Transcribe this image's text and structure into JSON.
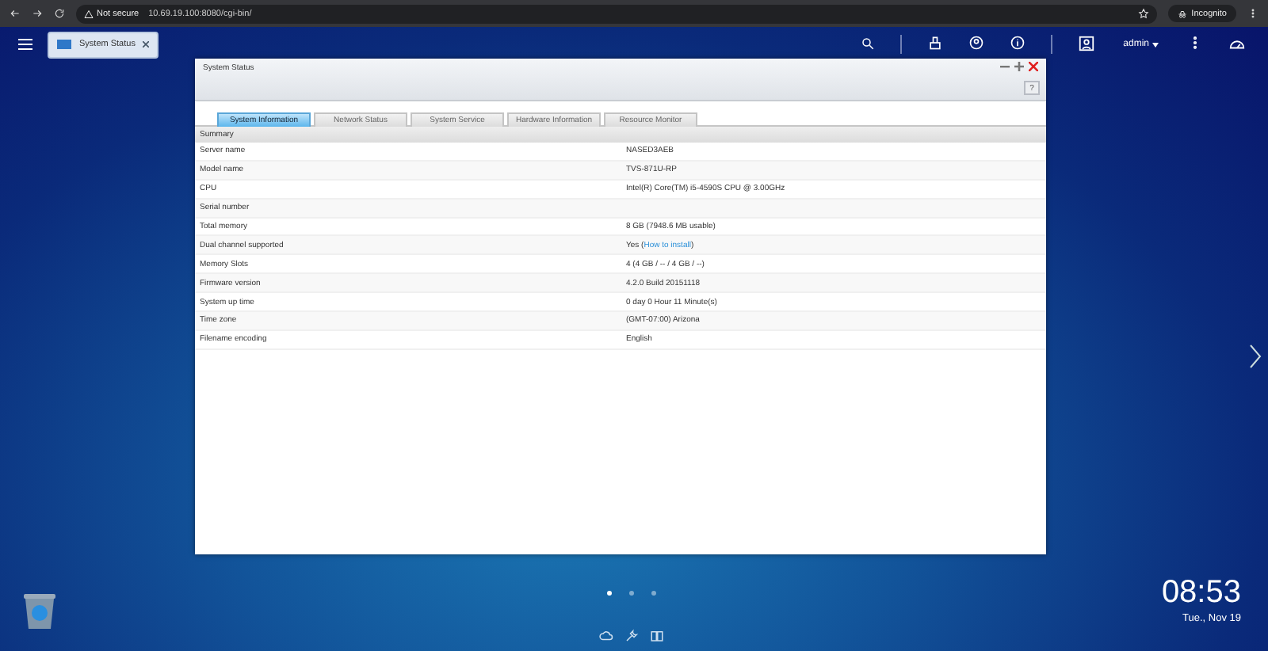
{
  "browser": {
    "security": "Not secure",
    "url": "10.69.19.100:8080/cgi-bin/",
    "profile": "Incognito"
  },
  "taskbar": {
    "tabs": [
      {
        "label": "System Status",
        "selected": true
      }
    ],
    "user": "admin"
  },
  "window": {
    "title": "System Status",
    "help": "?",
    "tabs": [
      {
        "label": "System Information",
        "selected": true
      },
      {
        "label": "Network Status",
        "selected": false
      },
      {
        "label": "System Service",
        "selected": false
      },
      {
        "label": "Hardware Information",
        "selected": false
      },
      {
        "label": "Resource Monitor",
        "selected": false
      }
    ],
    "section": "Summary",
    "rows": [
      {
        "label": "Server name",
        "value": "NASED3AEB"
      },
      {
        "label": "Model name",
        "value": "TVS-871U-RP"
      },
      {
        "label": "CPU",
        "value": "Intel(R) Core(TM) i5-4590S CPU @ 3.00GHz"
      },
      {
        "label": "Serial number"
      },
      {
        "label": "Total memory",
        "value": "8 GB (7948.6 MB usable)"
      },
      {
        "label": "Dual channel supported",
        "value": "Yes (",
        "link": "How to install",
        "after": ")"
      },
      {
        "label": "Memory Slots",
        "value": "4 (4 GB / -- / 4 GB / --)"
      },
      {
        "label": "Firmware version",
        "value": "4.2.0 Build 20151118"
      },
      {
        "label": "System up time",
        "value": "0 day 0 Hour 11 Minute(s)"
      },
      {
        "label": "Time zone",
        "value": "(GMT-07:00) Arizona"
      },
      {
        "label": "Filename encoding",
        "value": "English"
      }
    ]
  },
  "desktop": {
    "pages": [
      {
        "selected": true
      },
      {
        "selected": false
      },
      {
        "selected": false
      }
    ],
    "time": "08:53",
    "date": "Tue., Nov 19"
  }
}
